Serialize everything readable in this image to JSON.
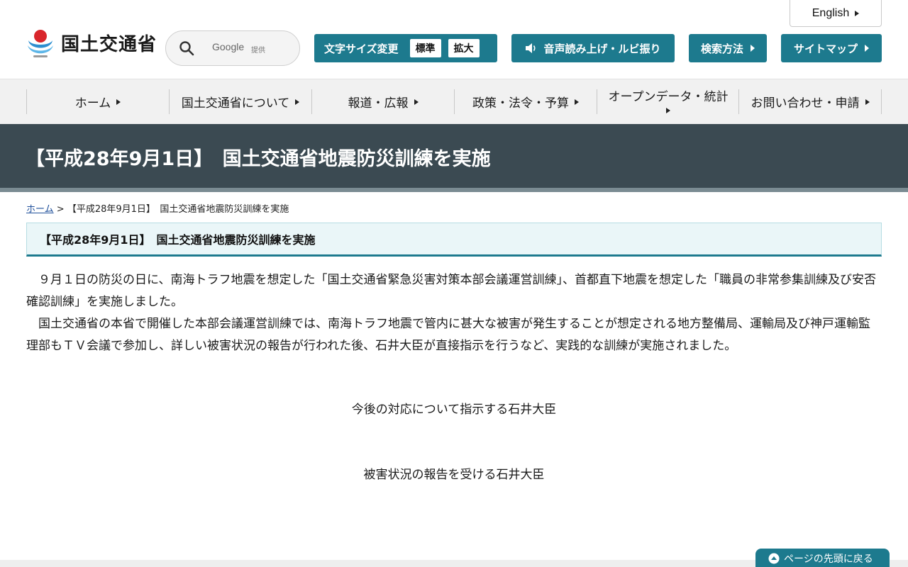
{
  "header": {
    "logo_text": "国土交通省",
    "search": {
      "provider": "Google",
      "provided_label": "提供"
    },
    "english_label": "English",
    "font_size_label": "文字サイズ変更",
    "font_size_options": [
      "標準",
      "拡大"
    ],
    "voice_label": "音声読み上げ・ルビ振り",
    "search_method_label": "検索方法",
    "sitemap_label": "サイトマップ",
    "accent_color": "#1d7a8e"
  },
  "nav": {
    "items": [
      {
        "label": "ホーム"
      },
      {
        "label": "国土交通省について"
      },
      {
        "label": "報道・広報"
      },
      {
        "label": "政策・法令・予算"
      },
      {
        "label": "オープンデータ・統計"
      },
      {
        "label": "お問い合わせ・申請"
      }
    ]
  },
  "page": {
    "title": "【平成28年9月1日】　国土交通省地震防災訓練を実施",
    "breadcrumb": {
      "home": "ホーム",
      "separator": ">",
      "current": "【平成28年9月1日】　国土交通省地震防災訓練を実施"
    },
    "section_heading": "【平成28年9月1日】　国土交通省地震防災訓練を実施",
    "paragraph_1": "　９月１日の防災の日に、南海トラフ地震を想定した「国土交通省緊急災害対策本部会議運営訓練」、首都直下地震を想定した「職員の非常参集訓練及び安否確認訓練」を実施しました。",
    "paragraph_2": "　国土交通省の本省で開催した本部会議運営訓練では、南海トラフ地震で管内に甚大な被害が発生することが想定される地方整備局、運輸局及び神戸運輸監理部もＴＶ会議で参加し、詳しい被害状況の報告が行われた後、石井大臣が直接指示を行うなど、実践的な訓練が実施されました。",
    "caption_1": "今後の対応について指示する石井大臣",
    "caption_2": "被害状況の報告を受ける石井大臣",
    "back_to_top": "ページの先頭に戻る"
  }
}
